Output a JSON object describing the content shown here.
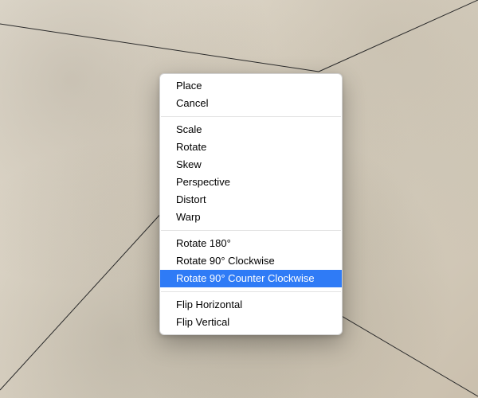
{
  "menu": {
    "group1": [
      {
        "label": "Place"
      },
      {
        "label": "Cancel"
      }
    ],
    "group2": [
      {
        "label": "Scale"
      },
      {
        "label": "Rotate"
      },
      {
        "label": "Skew"
      },
      {
        "label": "Perspective"
      },
      {
        "label": "Distort"
      },
      {
        "label": "Warp"
      }
    ],
    "group3": [
      {
        "label": "Rotate 180°"
      },
      {
        "label": "Rotate 90° Clockwise"
      },
      {
        "label": "Rotate 90° Counter Clockwise",
        "highlighted": true
      }
    ],
    "group4": [
      {
        "label": "Flip Horizontal"
      },
      {
        "label": "Flip Vertical"
      }
    ]
  },
  "background": {
    "description": "weathered concrete texture with diagonal placed-layer bounding lines converging near center-left"
  }
}
